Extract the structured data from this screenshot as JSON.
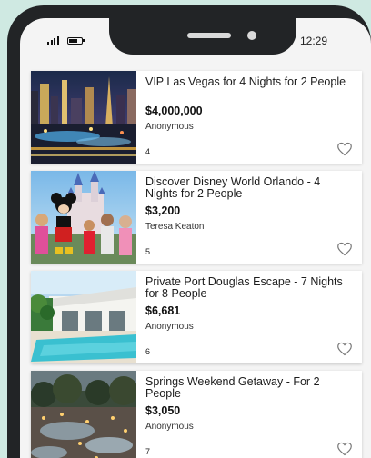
{
  "status_bar": {
    "time": "12:29",
    "signal_icon": "signal-icon",
    "battery_icon": "battery-icon"
  },
  "listings": [
    {
      "title": "VIP Las Vegas for 4 Nights for 2 People",
      "price": "$4,000,000",
      "bidder": "Anonymous",
      "count": "4",
      "image": "las-vegas-night-photo",
      "favorite_icon": "heart-outline-icon"
    },
    {
      "title": "Discover Disney World Orlando - 4 Nights for 2 People",
      "price": "$3,200",
      "bidder": "Teresa Keaton",
      "count": "5",
      "image": "disney-castle-family-photo",
      "favorite_icon": "heart-outline-icon"
    },
    {
      "title": "Private Port Douglas Escape - 7 Nights for 8 People",
      "price": "$6,681",
      "bidder": "Anonymous",
      "count": "6",
      "image": "villa-pool-photo",
      "favorite_icon": "heart-outline-icon"
    },
    {
      "title": "Springs Weekend Getaway - For 2 People",
      "price": "$3,050",
      "bidder": "Anonymous",
      "count": "7",
      "image": "hot-springs-resort-photo",
      "favorite_icon": "heart-outline-icon"
    }
  ],
  "colors": {
    "backdrop": "#cfe9e2",
    "phone_frame": "#222426",
    "screen_bg": "#f4f4f4",
    "card_bg": "#ffffff"
  }
}
